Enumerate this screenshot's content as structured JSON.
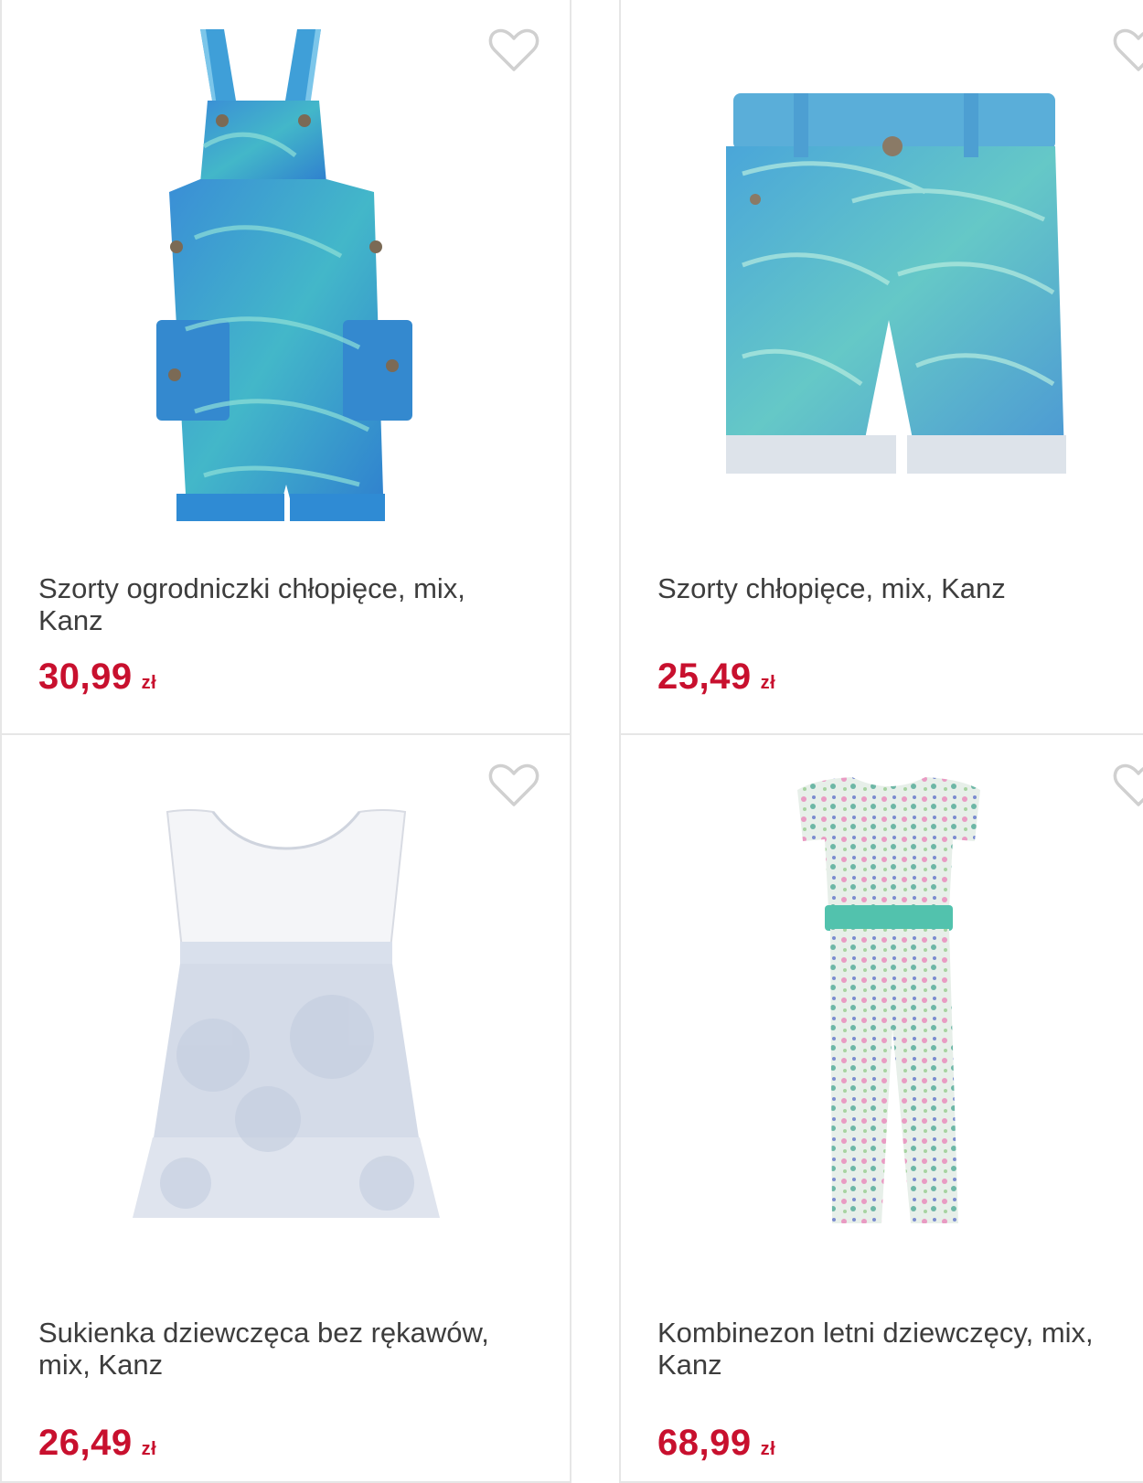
{
  "colors": {
    "price": "#c8102e",
    "text": "#3d3d3d",
    "border": "#e6e6e6",
    "favorite_icon": "#d0d0d0"
  },
  "products": [
    {
      "title": "Szorty ogrodniczki chłopięce, mix, Kanz",
      "price": "30,99",
      "currency": "zł",
      "image": "overall-shorts-image",
      "favorite_icon": "heart-outline-icon"
    },
    {
      "title": "Szorty chłopięce, mix, Kanz",
      "price": "25,49",
      "currency": "zł",
      "image": "shorts-image",
      "favorite_icon": "heart-outline-icon"
    },
    {
      "title": "Sukienka dziewczęca bez rękawów, mix, Kanz",
      "price": "26,49",
      "currency": "zł",
      "image": "dress-image",
      "favorite_icon": "heart-outline-icon"
    },
    {
      "title": "Kombinezon letni dziewczęcy, mix, Kanz",
      "price": "68,99",
      "currency": "zł",
      "image": "jumpsuit-image",
      "favorite_icon": "heart-outline-icon"
    }
  ]
}
